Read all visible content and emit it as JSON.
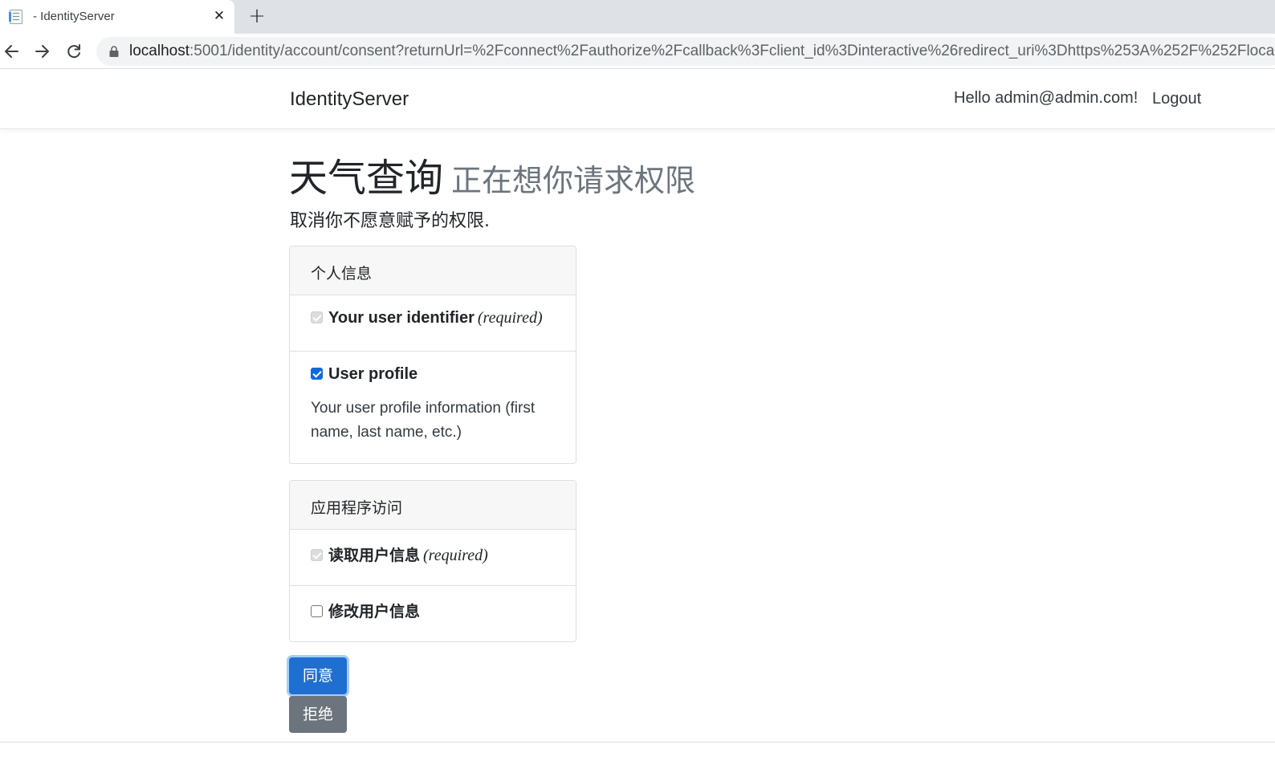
{
  "browser": {
    "tab_title": "- IdentityServer",
    "url_host": "localhost",
    "url_rest": ":5001/identity/account/consent?returnUrl=%2Fconnect%2Fauthorize%2Fcallback%3Fclient_id%3Dinteractive%26redirect_uri%3Dhttps%253A%252F%252Flocalho"
  },
  "nav": {
    "brand": "IdentityServer",
    "greeting": "Hello admin@admin.com!",
    "logout": "Logout"
  },
  "consent": {
    "client_name": "天气查询",
    "request_text": "正在想你请求权限",
    "subtitle": "取消你不愿意赋予的权限."
  },
  "identity_section": {
    "header": "个人信息",
    "scopes": [
      {
        "name": "Your user identifier",
        "required": "(required)",
        "checked": true,
        "disabled": true
      },
      {
        "name": "User profile",
        "description": "Your user profile information (first name, last name, etc.)",
        "checked": true,
        "disabled": false
      }
    ]
  },
  "api_section": {
    "header": "应用程序访问",
    "scopes": [
      {
        "name": "读取用户信息",
        "required": "(required)",
        "checked": true,
        "disabled": true
      },
      {
        "name": "修改用户信息",
        "checked": false,
        "disabled": false
      }
    ]
  },
  "buttons": {
    "yes": "同意",
    "no": "拒绝"
  },
  "colors": {
    "primary": "#1f6fd1",
    "secondary": "#6c757d",
    "card_header": "#f7f7f7"
  }
}
